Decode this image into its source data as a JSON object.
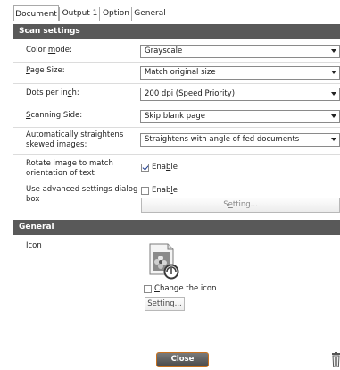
{
  "tabs": [
    {
      "label": "Document"
    },
    {
      "label": "Output 1"
    },
    {
      "label": "Option"
    },
    {
      "label": "General"
    }
  ],
  "scan_settings": {
    "header": "Scan settings",
    "color_mode": {
      "label_pre": "Color ",
      "label_u": "m",
      "label_post": "ode:",
      "value": "Grayscale"
    },
    "page_size": {
      "label_pre": "",
      "label_u": "P",
      "label_post": "age Size:",
      "value": "Match original size"
    },
    "dpi": {
      "label_pre": "Dots per in",
      "label_u": "c",
      "label_post": "h:",
      "value": "200 dpi (Speed Priority)"
    },
    "side": {
      "label_pre": "",
      "label_u": "S",
      "label_post": "canning Side:",
      "value": "Skip blank page"
    },
    "straighten": {
      "label_line1": "Automatically straightens",
      "label_line2": "skewed images:",
      "value": "Straightens with angle of fed documents"
    },
    "rotate": {
      "label_line1": "Rotate image to match",
      "label_line2": "orientation of text",
      "enable_pre": "Ena",
      "enable_u": "b",
      "enable_post": "le",
      "checked": true
    },
    "advanced": {
      "label_line1": "Use advanced settings dialog",
      "label_line2": "box",
      "enable_pre": "Enab",
      "enable_u": "l",
      "enable_post": "e",
      "checked": false,
      "setting_pre": "S",
      "setting_u": "e",
      "setting_post": "tting..."
    }
  },
  "general": {
    "header": "General",
    "icon_label": "Icon",
    "change_icon_u": "C",
    "change_icon_post": "hange the icon",
    "change_icon_checked": false,
    "setting_label": "Setting..."
  },
  "footer": {
    "close_label": "Close"
  },
  "colors": {
    "section_bg": "#595959",
    "close_border": "#c9711e"
  }
}
